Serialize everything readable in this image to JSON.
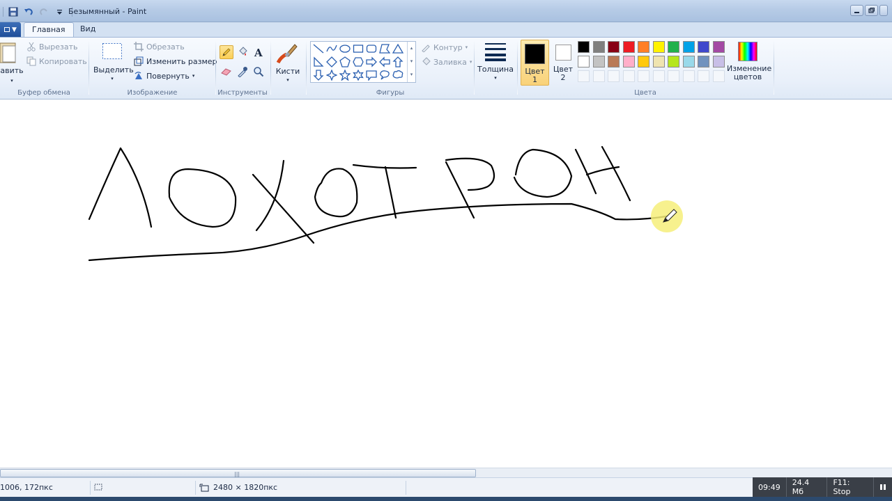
{
  "window": {
    "title": "Безымянный - Paint"
  },
  "tabs": {
    "file_label": "▼",
    "home": "Главная",
    "view": "Вид"
  },
  "clipboard": {
    "paste_label": "авить",
    "cut_label": "Вырезать",
    "copy_label": "Копировать",
    "group_label": "Буфер обмена"
  },
  "image": {
    "select_label": "Выделить",
    "crop_label": "Обрезать",
    "resize_label": "Изменить размер",
    "rotate_label": "Повернуть",
    "group_label": "Изображение"
  },
  "tools": {
    "group_label": "Инструменты",
    "items": [
      "pencil-icon",
      "fill-icon",
      "text-icon",
      "eraser-icon",
      "color-picker-icon",
      "magnifier-icon"
    ]
  },
  "brushes": {
    "label": "Кисти"
  },
  "shapes": {
    "group_label": "Фигуры",
    "outline_label": "Контур",
    "fill_label": "Заливка"
  },
  "size": {
    "label": "Толщина"
  },
  "colors": {
    "group_label": "Цвета",
    "color1_label_line1": "Цвет",
    "color1_label_line2": "1",
    "color2_label_line1": "Цвет",
    "color2_label_line2": "2",
    "color1": "#000000",
    "color2": "#ffffff",
    "edit_label_line1": "Изменение",
    "edit_label_line2": "цветов",
    "palette_row1": [
      "#000000",
      "#7f7f7f",
      "#880015",
      "#ed1c24",
      "#ff7f27",
      "#fff200",
      "#22b14c",
      "#00a2e8",
      "#3f48cc",
      "#a349a4"
    ],
    "palette_row2": [
      "#ffffff",
      "#c3c3c3",
      "#b97a57",
      "#ffaec9",
      "#ffc90e",
      "#efe4b0",
      "#b5e61d",
      "#99d9ea",
      "#7092be",
      "#c8bfe7"
    ]
  },
  "canvas": {
    "drawn_text_note": ""
  },
  "status": {
    "cursor_pos": "1006, 172пкс",
    "image_size": "2480 × 1820пкс"
  },
  "recorder": {
    "time": "09:49",
    "size": "24.4 Мб",
    "stop": "F11: Stop"
  }
}
